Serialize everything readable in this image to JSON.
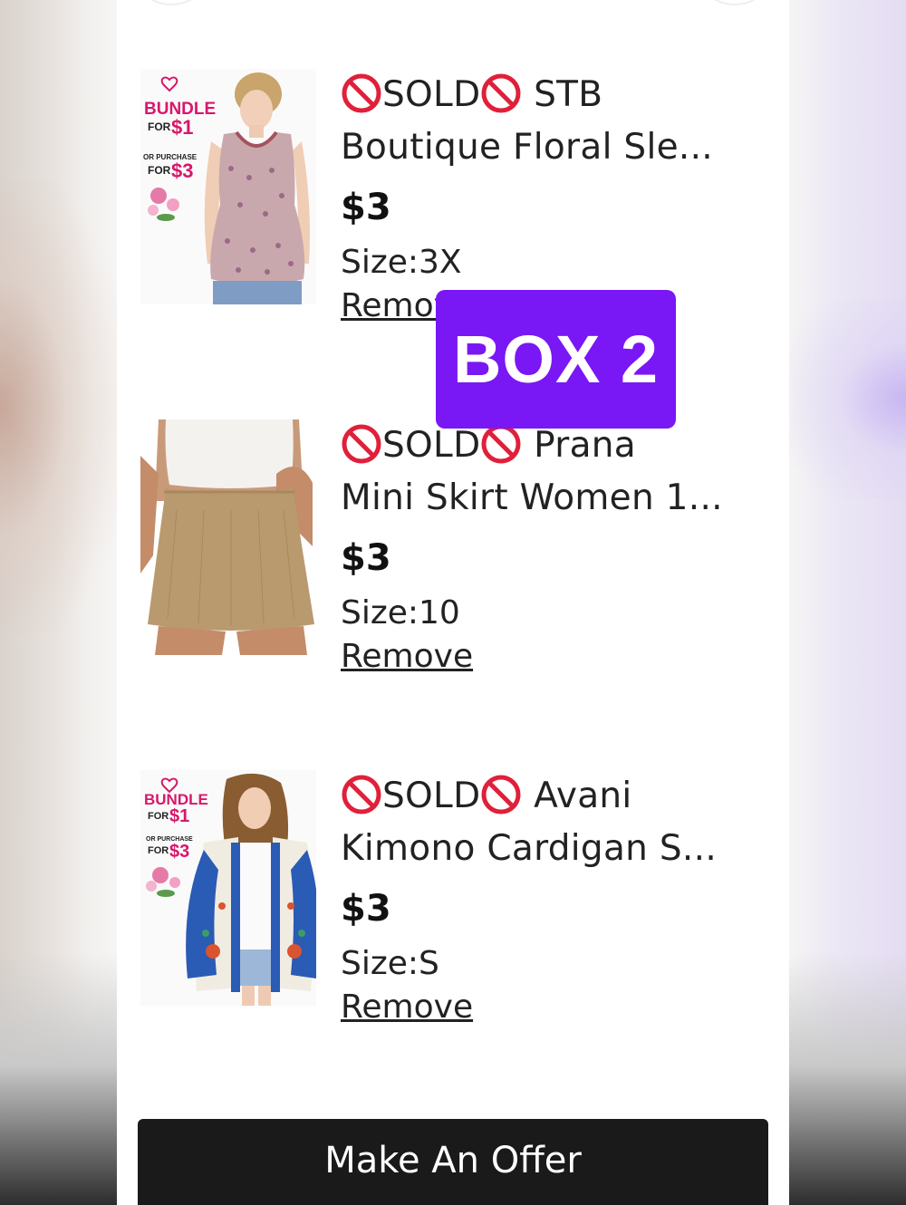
{
  "items": [
    {
      "sold_label": "SOLD",
      "title_line1": "STB",
      "title_line2": "Boutique Floral Sle...",
      "price": "$3",
      "size_label": "Size:",
      "size_value": "3X",
      "remove_label": "Remove",
      "promo": {
        "line1": "BUNDLE",
        "line2": "FOR",
        "line3": "$1",
        "line4": "OR PURCHASE",
        "line5": "FOR",
        "line6": "$3"
      }
    },
    {
      "sold_label": "SOLD",
      "title_line1": "Prana",
      "title_line2": "Mini Skirt Women 1...",
      "price": "$3",
      "size_label": "Size:",
      "size_value": "10",
      "remove_label": "Remove"
    },
    {
      "sold_label": "SOLD",
      "title_line1": "Avani",
      "title_line2": "Kimono Cardigan S...",
      "price": "$3",
      "size_label": "Size:",
      "size_value": "S",
      "remove_label": "Remove",
      "promo": {
        "line1": "BUNDLE",
        "line2": "FOR",
        "line3": "$1",
        "line4": "OR PURCHASE",
        "line5": "FOR",
        "line6": "$3"
      }
    }
  ],
  "overlay_label": "BOX 2",
  "offer_button_label": "Make An Offer",
  "colors": {
    "overlay": "#7a17f5",
    "button": "#1a1a1a",
    "sold_icon": "#e0203a",
    "promo_pink": "#d8176a"
  },
  "icons": {
    "sold": "prohibited-icon"
  }
}
